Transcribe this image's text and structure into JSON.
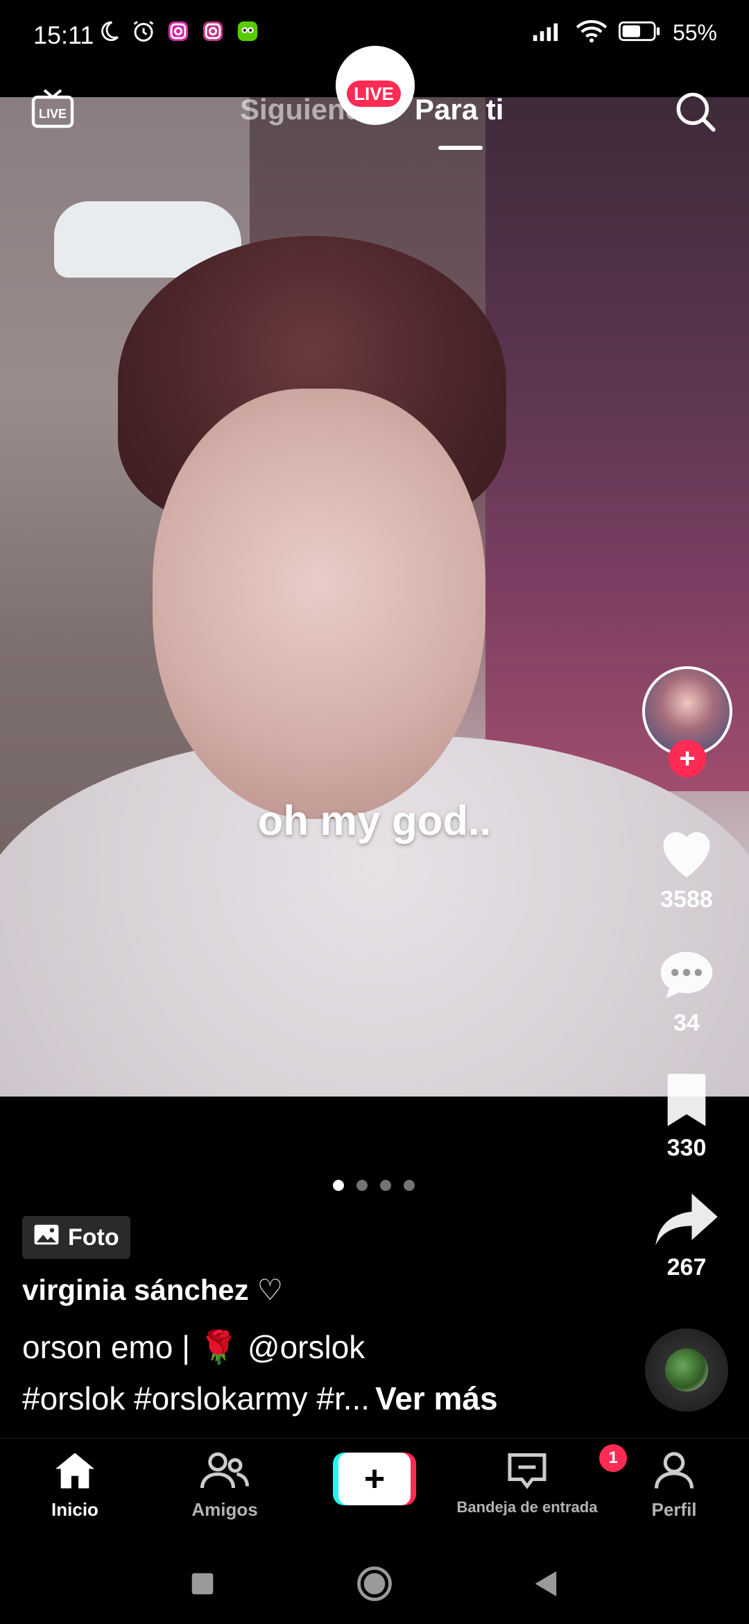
{
  "status_bar": {
    "time": "15:11",
    "battery_text": "55%",
    "icons": [
      "moon-icon",
      "alarm-icon",
      "instagram-icon",
      "instagram-icon",
      "duolingo-icon",
      "signal-icon",
      "wifi-icon",
      "battery-icon"
    ]
  },
  "top_nav": {
    "tab_following": "Siguiendo",
    "tab_foryou": "Para ti",
    "live_badge": "LIVE",
    "live_tv_icon": "live-tv-icon",
    "search_icon": "search-icon"
  },
  "post": {
    "caption_overlay": "oh my god..",
    "type_label": "Foto",
    "author": "virginia sánchez ♡",
    "description_line1": "orson emo | 🌹 @orslok",
    "description_line2": "#orslok #orslokarmy #r...",
    "see_more": "Ver más",
    "carousel_dots": 4,
    "active_dot": 1
  },
  "actions": {
    "likes": "3588",
    "comments": "34",
    "saves": "330",
    "shares": "267"
  },
  "bottom_nav": {
    "home": "Inicio",
    "friends": "Amigos",
    "inbox": "Bandeja de entrada",
    "inbox_badge": "1",
    "profile": "Perfil"
  },
  "colors": {
    "accent": "#fe2c55",
    "cyan": "#25f4ee",
    "background": "#000000"
  }
}
